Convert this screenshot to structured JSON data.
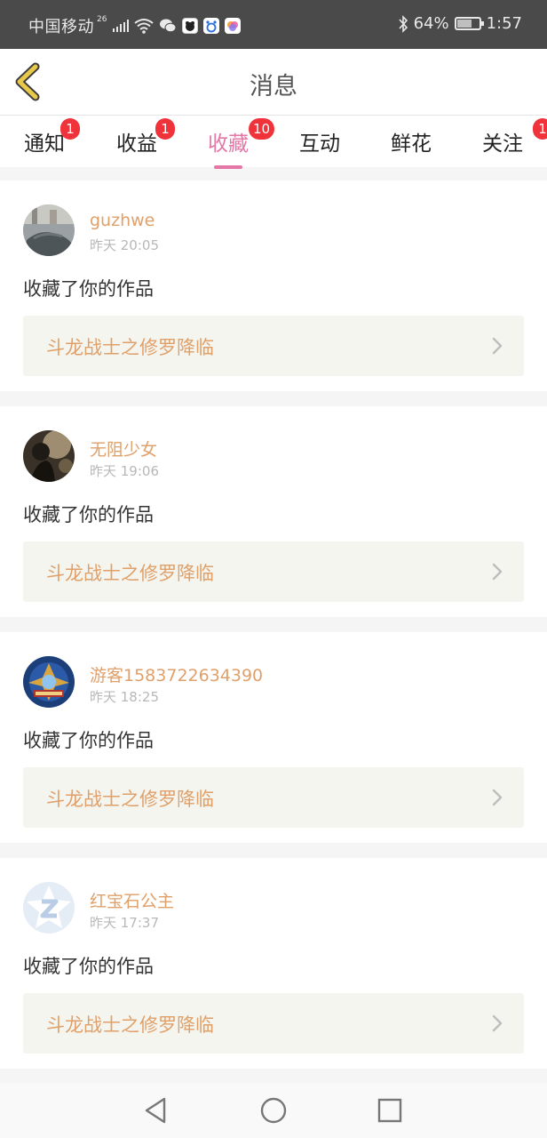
{
  "status_bar": {
    "carrier": "中国移动",
    "network": "26",
    "battery": "64%",
    "battery_level": 0.64,
    "time": "1:57",
    "icons": [
      "signal-icon",
      "wifi-icon",
      "wechat-icon",
      "app-icon",
      "baidu-icon",
      "app-icon",
      "bluetooth-icon",
      "battery-icon"
    ]
  },
  "header": {
    "title": "消息",
    "back_icon": "chevron-left-icon"
  },
  "tabs": [
    {
      "label": "通知",
      "badge": "1",
      "active": false
    },
    {
      "label": "收益",
      "badge": "1",
      "active": false
    },
    {
      "label": "收藏",
      "badge": "10",
      "active": true
    },
    {
      "label": "互动",
      "badge": "",
      "active": false
    },
    {
      "label": "鲜花",
      "badge": "",
      "active": false
    },
    {
      "label": "关注",
      "badge": "1",
      "active": false
    }
  ],
  "messages": [
    {
      "username": "guzhwe",
      "time": "昨天 20:05",
      "action": "收藏了你的作品",
      "work_title": "斗龙战士之修罗降临"
    },
    {
      "username": "无阻少女",
      "time": "昨天 19:06",
      "action": "收藏了你的作品",
      "work_title": "斗龙战士之修罗降临"
    },
    {
      "username": "游客1583722634390",
      "time": "昨天 18:25",
      "action": "收藏了你的作品",
      "work_title": "斗龙战士之修罗降临"
    },
    {
      "username": "红宝石公主",
      "time": "昨天 17:37",
      "action": "收藏了你的作品",
      "work_title": "斗龙战士之修罗降临"
    }
  ],
  "colors": {
    "accent_pink": "#e477a8",
    "badge_red": "#f0323a",
    "username_orange": "#e0a06a",
    "back_arrow_yellow": "#e8c84a"
  },
  "navbar": {
    "icons": [
      "back-triangle-icon",
      "home-circle-icon",
      "recents-square-icon"
    ]
  }
}
